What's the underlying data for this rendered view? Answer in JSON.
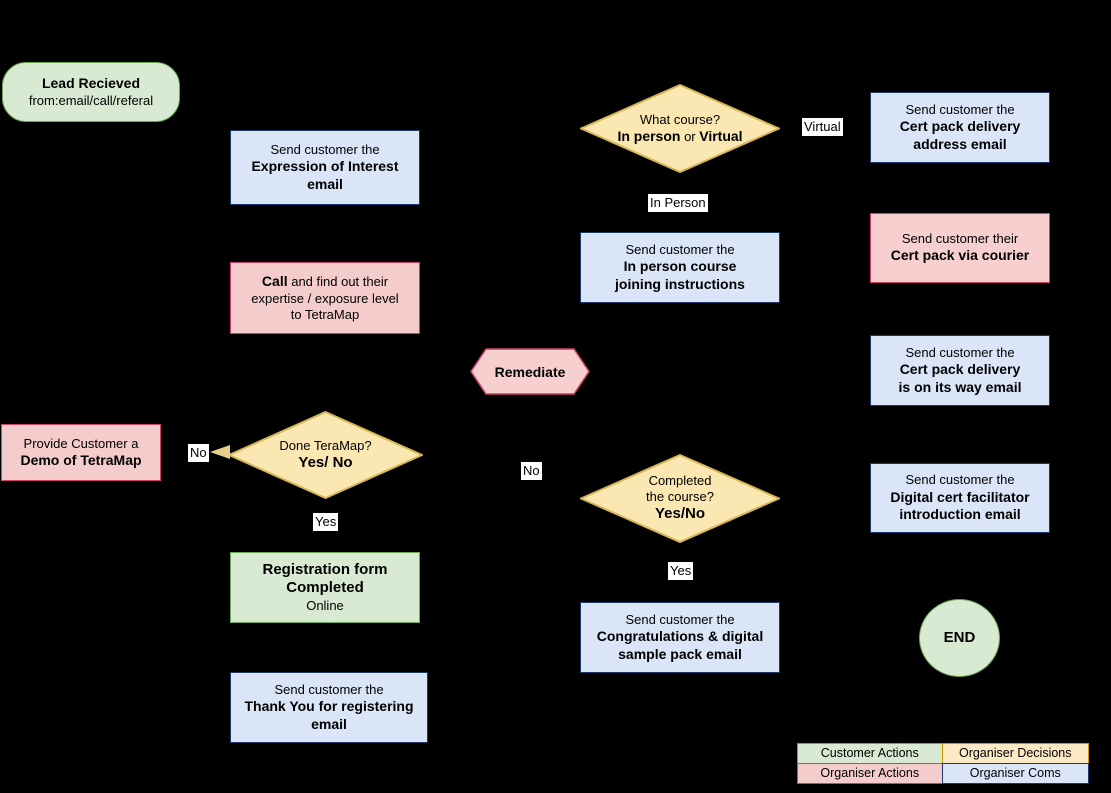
{
  "diagram": {
    "title": "Customer course onboarding flowchart",
    "background": "#000000",
    "palette": {
      "customer_actions_fill": "#d9ead3",
      "customer_actions_stroke": "#6aa84f",
      "organiser_actions_fill": "#f4cccc",
      "organiser_actions_stroke": "#cc4466",
      "organiser_decisions_fill": "#fce5cd",
      "organiser_decisions_stroke": "#cc9900",
      "organiser_coms_fill": "#dae5f7",
      "organiser_coms_stroke": "#1b3a6b",
      "diamond_fill": "#fbe7b2",
      "diamond_stroke": "#d6b656",
      "edge_label_bg": "#ffffff"
    }
  },
  "nodes": {
    "lead_received": {
      "line1": "Lead Recieved",
      "line2": "from:email/call/referal"
    },
    "expression_of_interest": {
      "line1": "Send customer the",
      "line2": "Expression of Interest",
      "line3": "email"
    },
    "call_expertise": {
      "bold1": "Call",
      "rest1": " and find out their",
      "line2": "expertise / exposure level",
      "line3": "to TetraMap"
    },
    "demo": {
      "line1": "Provide Customer a",
      "line2": "Demo of TetraMap"
    },
    "done_terramap": {
      "line1": "Done TeraMap?",
      "line2": "Yes/ No"
    },
    "registration_form": {
      "line1": "Registration form",
      "line2": "Completed",
      "line3": "Online"
    },
    "thank_you": {
      "line1": "Send customer the",
      "line2": "Thank You for registering",
      "line3": "email"
    },
    "what_course": {
      "line1": "What course?",
      "bold_a": "In person",
      "mid": " or ",
      "bold_b": "Virtual"
    },
    "in_person_joining": {
      "line1": "Send customer the",
      "line2": "In person course",
      "line3": "joining instructions"
    },
    "remediate": {
      "label": "Remediate"
    },
    "completed_course": {
      "line1": "Completed",
      "line2": "the course?",
      "line3": "Yes/No"
    },
    "congratulations": {
      "line1": "Send customer the",
      "line2": "Congratulations & digital",
      "line3": "sample pack email"
    },
    "cert_pack_address": {
      "line1": "Send customer the",
      "line2": "Cert pack delivery",
      "line3": "address email"
    },
    "cert_pack_courier": {
      "line1": "Send customer their",
      "line2": "Cert pack via courier"
    },
    "cert_pack_on_way": {
      "line1": "Send customer the",
      "line2": "Cert pack delivery",
      "line3": "is on its way email"
    },
    "digital_cert_intro": {
      "line1": "Send customer the",
      "line2": "Digital cert facilitator",
      "line3": "introduction email"
    },
    "end": {
      "label": "END"
    }
  },
  "edge_labels": {
    "no_demo": "No",
    "yes_registration": "Yes",
    "virtual": "Virtual",
    "in_person": "In Person",
    "no_remediate": "No",
    "yes_congrats": "Yes"
  },
  "legend": {
    "customer_actions": "Customer Actions",
    "organiser_decisions": "Organiser Decisions",
    "organiser_actions": "Organiser Actions",
    "organiser_coms": "Organiser Coms"
  }
}
